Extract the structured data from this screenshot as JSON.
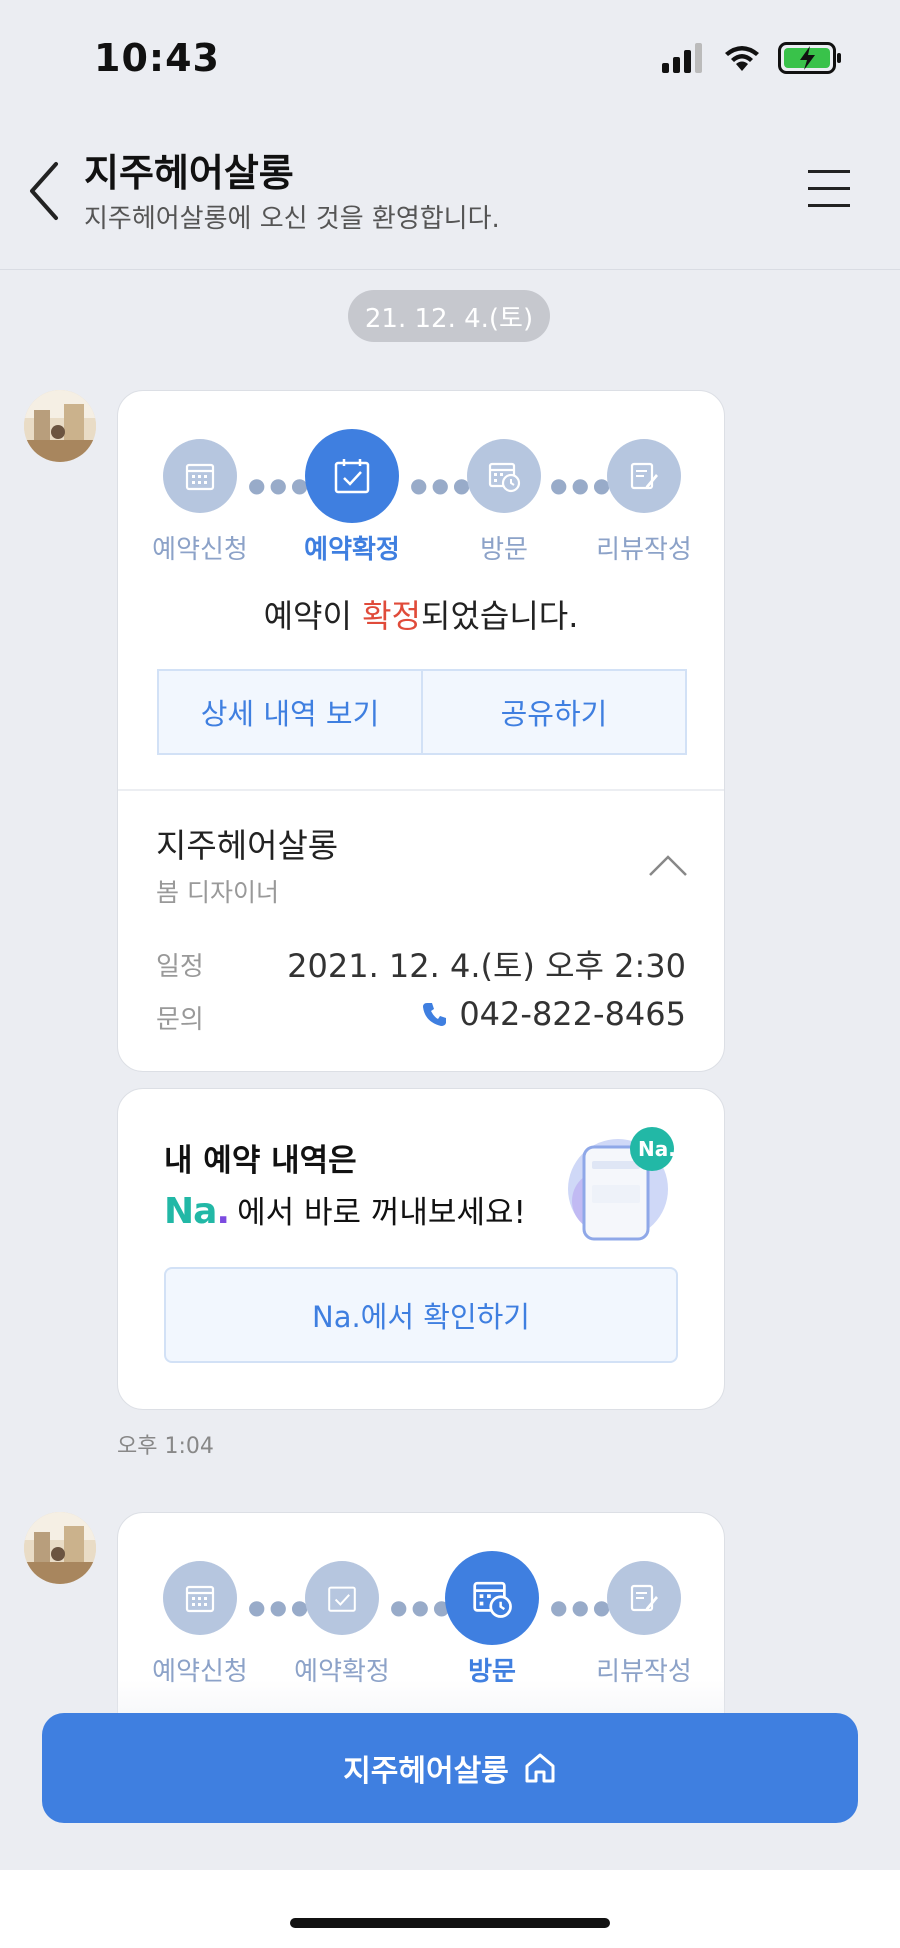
{
  "status_bar": {
    "time": "10:43"
  },
  "header": {
    "title": "지주헤어살롱",
    "subtitle": "지주헤어살롱에 오신 것을 환영합니다."
  },
  "chat": {
    "date": "21. 12. 4.(토)",
    "card1": {
      "steps": [
        {
          "label": "예약신청",
          "icon": "calendar-icon",
          "active": false
        },
        {
          "label": "예약확정",
          "icon": "calendar-check-icon",
          "active": true
        },
        {
          "label": "방문",
          "icon": "calendar-clock-icon",
          "active": false
        },
        {
          "label": "리뷰작성",
          "icon": "review-edit-icon",
          "active": false
        }
      ],
      "message": {
        "before": "예약이 ",
        "highlight": "확정",
        "after": "되었습니다."
      },
      "buttons": {
        "detail": "상세 내역 보기",
        "share": "공유하기"
      },
      "shop_name": "지주헤어살롱",
      "designer": "봄 디자이너",
      "schedule_label": "일정",
      "schedule_value": "2021. 12. 4.(토) 오후 2:30",
      "contact_label": "문의",
      "contact_value": "042-822-8465"
    },
    "na_card": {
      "title": "내 예약 내역은",
      "logo": "Na",
      "logo_dot": ".",
      "line_text": "에서 바로 꺼내보세요!",
      "badge": "Na.",
      "button": "Na.에서 확인하기"
    },
    "timestamp": "오후 1:04",
    "card2": {
      "steps": [
        {
          "label": "예약신청",
          "icon": "calendar-icon",
          "active": false
        },
        {
          "label": "예약확정",
          "icon": "calendar-check-icon",
          "active": false
        },
        {
          "label": "방문",
          "icon": "calendar-clock-icon",
          "active": true
        },
        {
          "label": "리뷰작성",
          "icon": "review-edit-icon",
          "active": false
        }
      ]
    }
  },
  "bottom_button": {
    "label": "지주헤어살롱",
    "icon": "home-icon"
  },
  "colors": {
    "accent": "#3f7fe0",
    "highlight": "#e04b3a",
    "step_inactive": "#b6c6df",
    "background": "#ebedf2"
  }
}
